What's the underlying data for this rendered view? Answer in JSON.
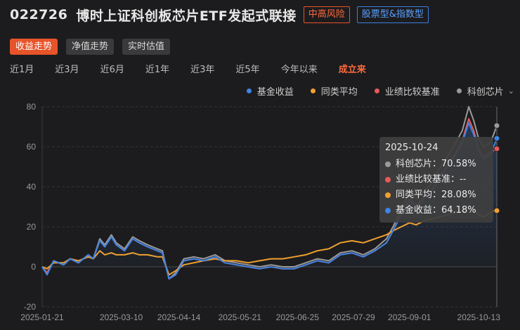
{
  "header": {
    "fund_code": "022726",
    "fund_name": "博时上证科创板芯片ETF发起式联接",
    "risk_tag": "中高风险",
    "type_tag": "股票型&指数型"
  },
  "view_tabs": [
    {
      "label": "收益走势",
      "active": true
    },
    {
      "label": "净值走势",
      "active": false
    },
    {
      "label": "实时估值",
      "active": false
    }
  ],
  "range_tabs": [
    {
      "label": "近1月",
      "active": false
    },
    {
      "label": "近3月",
      "active": false
    },
    {
      "label": "近6月",
      "active": false
    },
    {
      "label": "近1年",
      "active": false
    },
    {
      "label": "近3年",
      "active": false
    },
    {
      "label": "近5年",
      "active": false
    },
    {
      "label": "今年以来",
      "active": false
    },
    {
      "label": "成立来",
      "active": true
    }
  ],
  "colors": {
    "accent": "#e8542a",
    "fund": "#3d85e6",
    "peer": "#f0a030",
    "benchmark": "#e85a5a",
    "index": "#9a9a9a"
  },
  "tooltip": {
    "date": "2025-10-24",
    "rows": [
      {
        "label": "科创芯片：70.58%",
        "color": "#9a9a9a"
      },
      {
        "label": "业绩比较基准：--",
        "color": "#e85a5a"
      },
      {
        "label": "同类平均：28.08%",
        "color": "#f0a030"
      },
      {
        "label": "基金收益：64.18%",
        "color": "#3d85e6"
      }
    ]
  },
  "chart_data": {
    "type": "line",
    "ylim": [
      -20,
      80
    ],
    "yticks": [
      80,
      60,
      40,
      20,
      0,
      -20
    ],
    "xlim": [
      "2025-01-21",
      "2025-10-24"
    ],
    "xticks": [
      "2025-01-21",
      "2025-03-10",
      "2025-04-14",
      "2025-05-21",
      "2025-06-25",
      "2025-07-29",
      "2025-09-01",
      "2025-10-13"
    ],
    "grid": true,
    "legend_position": "top-right",
    "series": [
      {
        "name": "基金收益",
        "color": "#3d85e6",
        "points": [
          [
            "2025-01-21",
            0
          ],
          [
            "2025-01-24",
            -4
          ],
          [
            "2025-01-28",
            3
          ],
          [
            "2025-02-03",
            1
          ],
          [
            "2025-02-07",
            4
          ],
          [
            "2025-02-12",
            2
          ],
          [
            "2025-02-18",
            6
          ],
          [
            "2025-02-21",
            4
          ],
          [
            "2025-02-25",
            13
          ],
          [
            "2025-02-28",
            10
          ],
          [
            "2025-03-04",
            15
          ],
          [
            "2025-03-07",
            11
          ],
          [
            "2025-03-12",
            8
          ],
          [
            "2025-03-17",
            14
          ],
          [
            "2025-03-21",
            12
          ],
          [
            "2025-03-26",
            10
          ],
          [
            "2025-04-01",
            8
          ],
          [
            "2025-04-04",
            7
          ],
          [
            "2025-04-08",
            -6
          ],
          [
            "2025-04-12",
            -4
          ],
          [
            "2025-04-17",
            3
          ],
          [
            "2025-04-23",
            4
          ],
          [
            "2025-04-29",
            3
          ],
          [
            "2025-05-06",
            5
          ],
          [
            "2025-05-12",
            2
          ],
          [
            "2025-05-19",
            1
          ],
          [
            "2025-05-26",
            0
          ],
          [
            "2025-06-02",
            -1
          ],
          [
            "2025-06-09",
            0
          ],
          [
            "2025-06-16",
            -1
          ],
          [
            "2025-06-23",
            -1
          ],
          [
            "2025-06-30",
            1
          ],
          [
            "2025-07-07",
            3
          ],
          [
            "2025-07-14",
            2
          ],
          [
            "2025-07-21",
            6
          ],
          [
            "2025-07-28",
            7
          ],
          [
            "2025-08-04",
            5
          ],
          [
            "2025-08-11",
            8
          ],
          [
            "2025-08-18",
            12
          ],
          [
            "2025-08-22",
            18
          ],
          [
            "2025-08-27",
            26
          ],
          [
            "2025-09-01",
            33
          ],
          [
            "2025-09-05",
            30
          ],
          [
            "2025-09-10",
            34
          ],
          [
            "2025-09-15",
            38
          ],
          [
            "2025-09-19",
            44
          ],
          [
            "2025-09-24",
            50
          ],
          [
            "2025-09-29",
            56
          ],
          [
            "2025-10-03",
            62
          ],
          [
            "2025-10-07",
            72
          ],
          [
            "2025-10-10",
            66
          ],
          [
            "2025-10-13",
            58
          ],
          [
            "2025-10-16",
            54
          ],
          [
            "2025-10-20",
            56
          ],
          [
            "2025-10-22",
            60
          ],
          [
            "2025-10-24",
            64.18
          ]
        ]
      },
      {
        "name": "同类平均",
        "color": "#f0a030",
        "points": [
          [
            "2025-01-21",
            0
          ],
          [
            "2025-01-24",
            -1
          ],
          [
            "2025-01-28",
            2
          ],
          [
            "2025-02-03",
            2
          ],
          [
            "2025-02-07",
            4
          ],
          [
            "2025-02-12",
            3
          ],
          [
            "2025-02-18",
            5
          ],
          [
            "2025-02-21",
            4
          ],
          [
            "2025-02-25",
            8
          ],
          [
            "2025-02-28",
            6
          ],
          [
            "2025-03-04",
            7
          ],
          [
            "2025-03-07",
            6
          ],
          [
            "2025-03-12",
            6
          ],
          [
            "2025-03-17",
            7
          ],
          [
            "2025-03-21",
            6
          ],
          [
            "2025-03-26",
            6
          ],
          [
            "2025-04-01",
            5
          ],
          [
            "2025-04-04",
            5
          ],
          [
            "2025-04-08",
            -4
          ],
          [
            "2025-04-12",
            -2
          ],
          [
            "2025-04-17",
            1
          ],
          [
            "2025-04-23",
            2
          ],
          [
            "2025-04-29",
            3
          ],
          [
            "2025-05-06",
            4
          ],
          [
            "2025-05-12",
            3
          ],
          [
            "2025-05-19",
            3
          ],
          [
            "2025-05-26",
            2
          ],
          [
            "2025-06-02",
            3
          ],
          [
            "2025-06-09",
            4
          ],
          [
            "2025-06-16",
            4
          ],
          [
            "2025-06-23",
            5
          ],
          [
            "2025-06-30",
            6
          ],
          [
            "2025-07-07",
            8
          ],
          [
            "2025-07-14",
            9
          ],
          [
            "2025-07-21",
            12
          ],
          [
            "2025-07-28",
            13
          ],
          [
            "2025-08-04",
            12
          ],
          [
            "2025-08-11",
            14
          ],
          [
            "2025-08-18",
            16
          ],
          [
            "2025-08-22",
            18
          ],
          [
            "2025-08-27",
            20
          ],
          [
            "2025-09-01",
            22
          ],
          [
            "2025-09-05",
            21
          ],
          [
            "2025-09-10",
            23
          ],
          [
            "2025-09-15",
            24
          ],
          [
            "2025-09-19",
            25
          ],
          [
            "2025-09-24",
            26
          ],
          [
            "2025-09-29",
            27
          ],
          [
            "2025-10-03",
            28
          ],
          [
            "2025-10-07",
            30
          ],
          [
            "2025-10-10",
            29
          ],
          [
            "2025-10-13",
            26
          ],
          [
            "2025-10-16",
            25
          ],
          [
            "2025-10-20",
            27
          ],
          [
            "2025-10-22",
            28
          ],
          [
            "2025-10-24",
            28.08
          ]
        ]
      },
      {
        "name": "业绩比较基准",
        "color": "#e85a5a",
        "points": [
          [
            "2025-01-21",
            0
          ],
          [
            "2025-01-24",
            -3
          ],
          [
            "2025-01-28",
            3
          ],
          [
            "2025-02-03",
            1
          ],
          [
            "2025-02-07",
            4
          ],
          [
            "2025-02-12",
            2
          ],
          [
            "2025-02-18",
            6
          ],
          [
            "2025-02-21",
            4
          ],
          [
            "2025-02-25",
            13
          ],
          [
            "2025-02-28",
            10
          ],
          [
            "2025-03-04",
            15
          ],
          [
            "2025-03-07",
            11
          ],
          [
            "2025-03-12",
            8
          ],
          [
            "2025-03-17",
            14
          ],
          [
            "2025-03-21",
            12
          ],
          [
            "2025-03-26",
            10
          ],
          [
            "2025-04-01",
            8
          ],
          [
            "2025-04-04",
            7
          ],
          [
            "2025-04-08",
            -6
          ],
          [
            "2025-04-12",
            -4
          ],
          [
            "2025-04-17",
            3
          ],
          [
            "2025-04-23",
            4
          ],
          [
            "2025-04-29",
            3
          ],
          [
            "2025-05-06",
            5
          ],
          [
            "2025-05-12",
            2
          ],
          [
            "2025-05-19",
            1
          ],
          [
            "2025-05-26",
            0
          ],
          [
            "2025-06-02",
            -1
          ],
          [
            "2025-06-09",
            0
          ],
          [
            "2025-06-16",
            -1
          ],
          [
            "2025-06-23",
            -1
          ],
          [
            "2025-06-30",
            1
          ],
          [
            "2025-07-07",
            3
          ],
          [
            "2025-07-14",
            2
          ],
          [
            "2025-07-21",
            6
          ],
          [
            "2025-07-28",
            7
          ],
          [
            "2025-08-04",
            5
          ],
          [
            "2025-08-11",
            8
          ],
          [
            "2025-08-18",
            12
          ],
          [
            "2025-08-22",
            18
          ],
          [
            "2025-08-27",
            27
          ],
          [
            "2025-09-01",
            34
          ],
          [
            "2025-09-05",
            31
          ],
          [
            "2025-09-10",
            35
          ],
          [
            "2025-09-15",
            39
          ],
          [
            "2025-09-19",
            45
          ],
          [
            "2025-09-24",
            51
          ],
          [
            "2025-09-29",
            57
          ],
          [
            "2025-10-03",
            63
          ],
          [
            "2025-10-07",
            74
          ],
          [
            "2025-10-10",
            68
          ],
          [
            "2025-10-13",
            59
          ],
          [
            "2025-10-16",
            55
          ],
          [
            "2025-10-20",
            57
          ],
          [
            "2025-10-22",
            58
          ],
          [
            "2025-10-24",
            59
          ]
        ]
      },
      {
        "name": "科创芯片",
        "color": "#9a9a9a",
        "points": [
          [
            "2025-01-21",
            0
          ],
          [
            "2025-01-24",
            -3
          ],
          [
            "2025-01-28",
            3
          ],
          [
            "2025-02-03",
            1
          ],
          [
            "2025-02-07",
            4
          ],
          [
            "2025-02-12",
            2
          ],
          [
            "2025-02-18",
            6
          ],
          [
            "2025-02-21",
            4
          ],
          [
            "2025-02-25",
            14
          ],
          [
            "2025-02-28",
            11
          ],
          [
            "2025-03-04",
            16
          ],
          [
            "2025-03-07",
            12
          ],
          [
            "2025-03-12",
            9
          ],
          [
            "2025-03-17",
            15
          ],
          [
            "2025-03-21",
            13
          ],
          [
            "2025-03-26",
            11
          ],
          [
            "2025-04-01",
            9
          ],
          [
            "2025-04-04",
            8
          ],
          [
            "2025-04-08",
            -6
          ],
          [
            "2025-04-12",
            -3
          ],
          [
            "2025-04-17",
            4
          ],
          [
            "2025-04-23",
            5
          ],
          [
            "2025-04-29",
            4
          ],
          [
            "2025-05-06",
            6
          ],
          [
            "2025-05-12",
            3
          ],
          [
            "2025-05-19",
            2
          ],
          [
            "2025-05-26",
            1
          ],
          [
            "2025-06-02",
            0
          ],
          [
            "2025-06-09",
            1
          ],
          [
            "2025-06-16",
            0
          ],
          [
            "2025-06-23",
            0
          ],
          [
            "2025-06-30",
            2
          ],
          [
            "2025-07-07",
            4
          ],
          [
            "2025-07-14",
            3
          ],
          [
            "2025-07-21",
            7
          ],
          [
            "2025-07-28",
            8
          ],
          [
            "2025-08-04",
            6
          ],
          [
            "2025-08-11",
            9
          ],
          [
            "2025-08-18",
            14
          ],
          [
            "2025-08-22",
            20
          ],
          [
            "2025-08-27",
            29
          ],
          [
            "2025-09-01",
            37
          ],
          [
            "2025-09-05",
            34
          ],
          [
            "2025-09-10",
            38
          ],
          [
            "2025-09-15",
            42
          ],
          [
            "2025-09-19",
            49
          ],
          [
            "2025-09-24",
            55
          ],
          [
            "2025-09-29",
            62
          ],
          [
            "2025-10-03",
            68
          ],
          [
            "2025-10-07",
            80
          ],
          [
            "2025-10-10",
            73
          ],
          [
            "2025-10-13",
            64
          ],
          [
            "2025-10-16",
            60
          ],
          [
            "2025-10-20",
            62
          ],
          [
            "2025-10-22",
            66
          ],
          [
            "2025-10-24",
            70.58
          ]
        ]
      }
    ]
  }
}
